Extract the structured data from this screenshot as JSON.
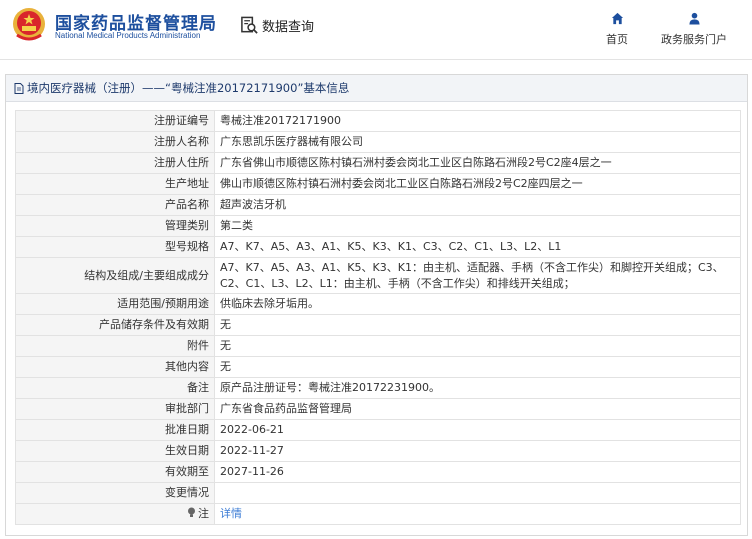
{
  "header": {
    "org_cn": "国家药品监督管理局",
    "org_en": "National Medical Products Administration",
    "search_label": "数据查询",
    "nav_home": "首页",
    "nav_gov": "政务服务门户"
  },
  "panel": {
    "title": "境内医疗器械（注册）——“粤械注准20172171900”基本信息"
  },
  "rows": [
    {
      "key": "注册证编号",
      "value": "粤械注准20172171900"
    },
    {
      "key": "注册人名称",
      "value": "广东思凯乐医疗器械有限公司"
    },
    {
      "key": "注册人住所",
      "value": "广东省佛山市顺德区陈村镇石洲村委会岗北工业区白陈路石洲段2号C2座4层之一"
    },
    {
      "key": "生产地址",
      "value": "佛山市顺德区陈村镇石洲村委会岗北工业区白陈路石洲段2号C2座四层之一"
    },
    {
      "key": "产品名称",
      "value": "超声波洁牙机"
    },
    {
      "key": "管理类别",
      "value": "第二类"
    },
    {
      "key": "型号规格",
      "value": "A7、K7、A5、A3、A1、K5、K3、K1、C3、C2、C1、L3、L2、L1"
    },
    {
      "key": "结构及组成/主要组成成分",
      "value": "A7、K7、A5、A3、A1、K5、K3、K1：由主机、适配器、手柄（不含工作尖）和脚控开关组成；C3、C2、C1、L3、L2、L1：由主机、手柄（不含工作尖）和排线开关组成；"
    },
    {
      "key": "适用范围/预期用途",
      "value": "供临床去除牙垢用。"
    },
    {
      "key": "产品储存条件及有效期",
      "value": "无"
    },
    {
      "key": "附件",
      "value": "无"
    },
    {
      "key": "其他内容",
      "value": "无"
    },
    {
      "key": "备注",
      "value": "原产品注册证号：粤械注准20172231900。"
    },
    {
      "key": "审批部门",
      "value": "广东省食品药品监督管理局"
    },
    {
      "key": "批准日期",
      "value": "2022-06-21"
    },
    {
      "key": "生效日期",
      "value": "2022-11-27"
    },
    {
      "key": "有效期至",
      "value": "2027-11-26"
    },
    {
      "key": "变更情况",
      "value": ""
    },
    {
      "key": "注",
      "value": "详情"
    }
  ],
  "colors": {
    "brand_blue": "#1d4f9e",
    "link_blue": "#3a7bd5",
    "key_bg": "#f5f5f5",
    "emblem_red": "#d9262b",
    "emblem_gold": "#e9b23b"
  }
}
